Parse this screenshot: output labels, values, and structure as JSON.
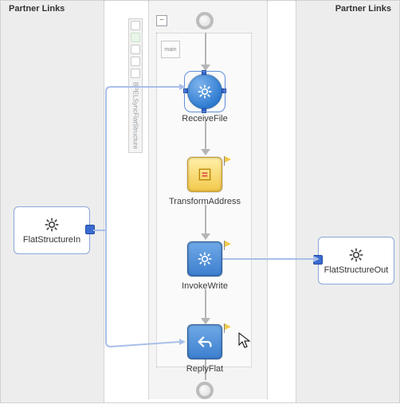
{
  "headers": {
    "left": "Partner Links",
    "right": "Partner Links"
  },
  "partners": {
    "left": {
      "name": "FlatStructureIn"
    },
    "right": {
      "name": "FlatStructureOut"
    }
  },
  "collapse_glyph": "−",
  "scope_badge": "main",
  "palette_text": "BPELSyncFlatStructure",
  "nodes": {
    "receive": {
      "label": "ReceiveFile"
    },
    "transform": {
      "label": "TransformAddress"
    },
    "invoke": {
      "label": "InvokeWrite"
    },
    "reply": {
      "label": "ReplyFlat"
    }
  }
}
